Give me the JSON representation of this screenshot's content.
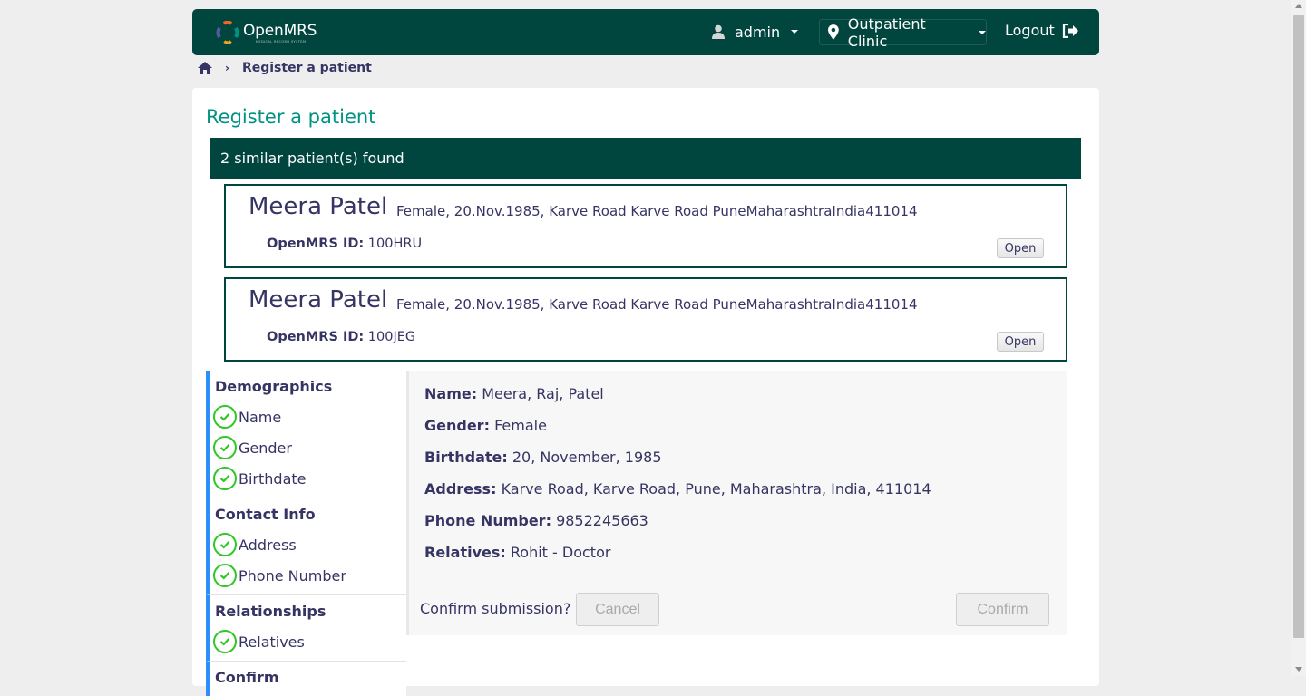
{
  "header": {
    "logo_text": "OpenMRS",
    "logo_subtext": "MEDICAL RECORD SYSTEM",
    "user_name": "admin",
    "location": "Outpatient Clinic",
    "logout_label": "Logout"
  },
  "breadcrumb": {
    "home_icon": "home-icon",
    "current": "Register a patient"
  },
  "page": {
    "title": "Register a patient",
    "similar_banner": "2 similar patient(s) found"
  },
  "similar_patients": [
    {
      "name": "Meera Patel",
      "info": "Female, 20.Nov.1985, Karve Road Karve Road PuneMaharashtraIndia411014",
      "id_label": "OpenMRS ID:",
      "id_value": "100HRU",
      "open_label": "Open"
    },
    {
      "name": "Meera Patel",
      "info": "Female, 20.Nov.1985, Karve Road Karve Road PuneMaharashtraIndia411014",
      "id_label": "OpenMRS ID:",
      "id_value": "100JEG",
      "open_label": "Open"
    }
  ],
  "nav": {
    "demographics": {
      "title": "Demographics",
      "items": [
        "Name",
        "Gender",
        "Birthdate"
      ]
    },
    "contact": {
      "title": "Contact Info",
      "items": [
        "Address",
        "Phone Number"
      ]
    },
    "relationships": {
      "title": "Relationships",
      "items": [
        "Relatives"
      ]
    },
    "confirm": {
      "title": "Confirm"
    }
  },
  "summary": {
    "name_label": "Name:",
    "name_value": "Meera, Raj, Patel",
    "gender_label": "Gender:",
    "gender_value": "Female",
    "birthdate_label": "Birthdate:",
    "birthdate_value": "20, November, 1985",
    "address_label": "Address:",
    "address_value": "Karve Road, Karve Road, Pune, Maharashtra, India, 411014",
    "phone_label": "Phone Number:",
    "phone_value": "9852245663",
    "relatives_label": "Relatives:",
    "relatives_value": "Rohit - Doctor",
    "confirm_question": "Confirm submission?",
    "cancel_label": "Cancel",
    "confirm_label": "Confirm"
  },
  "colors": {
    "header_bg": "#00463f",
    "title_teal": "#009384",
    "text_navy": "#363463",
    "nav_accent": "#2d8ffb",
    "check_green": "#32c627"
  }
}
